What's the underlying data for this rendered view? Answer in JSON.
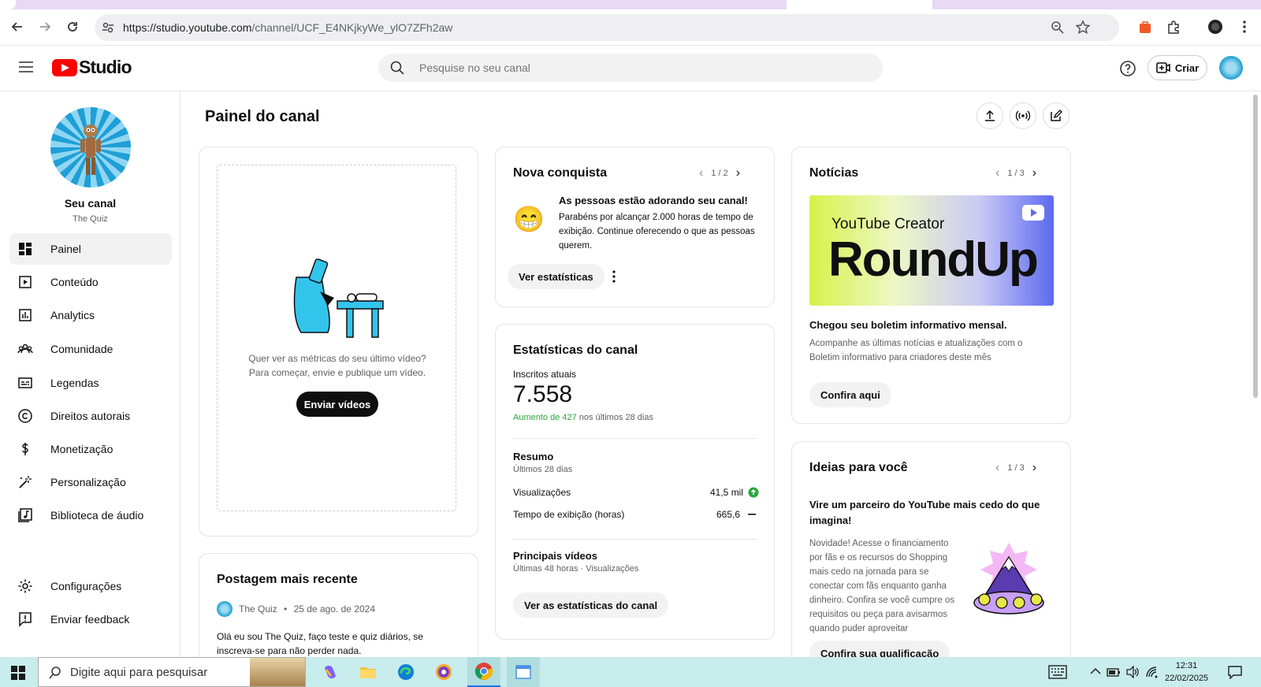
{
  "browser": {
    "url_host": "https://studio.youtube.com",
    "url_path": "/channel/UCF_E4NKjkyWe_ylO7ZFh2aw"
  },
  "header": {
    "logo_text": "Studio",
    "search_placeholder": "Pesquise no seu canal",
    "create_label": "Criar"
  },
  "sidebar": {
    "channel_name": "Seu canal",
    "channel_handle": "The Quiz",
    "items": [
      {
        "label": "Painel",
        "icon": "dashboard-icon"
      },
      {
        "label": "Conteúdo",
        "icon": "content-icon"
      },
      {
        "label": "Analytics",
        "icon": "analytics-icon"
      },
      {
        "label": "Comunidade",
        "icon": "community-icon"
      },
      {
        "label": "Legendas",
        "icon": "subtitles-icon"
      },
      {
        "label": "Direitos autorais",
        "icon": "copyright-icon"
      },
      {
        "label": "Monetização",
        "icon": "dollar-icon"
      },
      {
        "label": "Personalização",
        "icon": "magic-wand-icon"
      },
      {
        "label": "Biblioteca de áudio",
        "icon": "audio-library-icon"
      }
    ],
    "bottom_items": [
      {
        "label": "Configurações",
        "icon": "gear-icon"
      },
      {
        "label": "Enviar feedback",
        "icon": "feedback-icon"
      }
    ]
  },
  "main": {
    "title": "Painel do canal",
    "upload_card": {
      "line1": "Quer ver as métricas do seu último vídeo?",
      "line2": "Para começar, envie e publique um vídeo.",
      "button": "Enviar vídeos"
    },
    "recent_post": {
      "title": "Postagem mais recente",
      "author": "The Quiz",
      "separator": "•",
      "date": "25 de ago. de 2024",
      "text": "Olá eu sou The Quiz, faço teste e quiz diários, se inscreva-se para não perder nada."
    },
    "achievement": {
      "title": "Nova conquista",
      "pager": "1 / 2",
      "emoji": "😁",
      "headline": "As pessoas estão adorando seu canal!",
      "body": "Parabéns por alcançar 2.000 horas de tempo de exibição. Continue oferecendo o que as pessoas querem.",
      "button": "Ver estatísticas"
    },
    "stats": {
      "title": "Estatísticas do canal",
      "subs_label": "Inscritos atuais",
      "subs_value": "7.558",
      "subs_change": "Aumento de 427",
      "subs_change_suffix": "nos últimos 28 dias",
      "summary_title": "Resumo",
      "summary_period": "Últimos 28 dias",
      "rows": [
        {
          "label": "Visualizações",
          "value": "41,5 mil",
          "trend": "up"
        },
        {
          "label": "Tempo de exibição (horas)",
          "value": "665,6",
          "trend": "flat"
        }
      ],
      "top_videos_title": "Principais vídeos",
      "top_videos_sub": "Últimas 48 horas · Visualizações",
      "button": "Ver as estatísticas do canal"
    },
    "news": {
      "title": "Notícias",
      "pager": "1 / 3",
      "banner_small": "YouTube Creator",
      "banner_big": "RoundUp",
      "headline": "Chegou seu boletim informativo mensal.",
      "body": "Acompanhe as últimas notícias e atualizações com o Boletim informativo para criadores deste mês",
      "button": "Confira aqui"
    },
    "ideas": {
      "title": "Ideias para você",
      "pager": "1 / 3",
      "headline": "Vire um parceiro do YouTube mais cedo do que imagina!",
      "body": "Novidade! Acesse o financiamento por fãs e os recursos do Shopping mais cedo na jornada para se conectar com fãs enquanto ganha dinheiro. Confira se você cumpre os requisitos ou peça para avisarmos quando puder aproveitar",
      "button": "Confira sua qualificação"
    }
  },
  "taskbar": {
    "search_placeholder": "Digite aqui para pesquisar",
    "time": "12:31",
    "date": "22/02/2025"
  }
}
